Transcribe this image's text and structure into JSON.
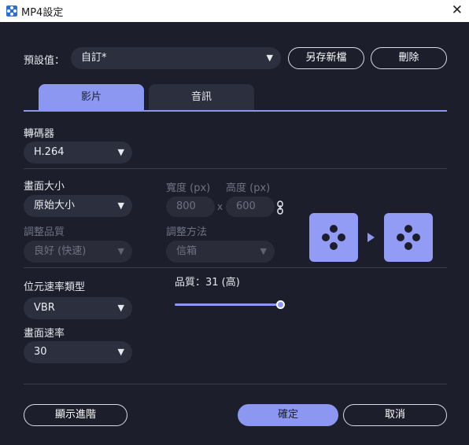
{
  "window": {
    "title": "MP4設定",
    "close_glyph": "✕"
  },
  "preset": {
    "label": "預設值：",
    "value": "自訂*",
    "save_new_label": "另存新檔",
    "delete_label": "刪除"
  },
  "tabs": [
    {
      "label": "影片",
      "active": true
    },
    {
      "label": "音訊",
      "active": false
    }
  ],
  "encoder": {
    "label": "轉碼器",
    "value": "H.264"
  },
  "frame_size": {
    "label": "畫面大小",
    "value": "原始大小",
    "width_label": "寬度 (px)",
    "height_label": "高度 (px)",
    "width_value": "800",
    "height_value": "600",
    "times": "x",
    "quality_label": "調整品質",
    "quality_value": "良好 (快速)",
    "method_label": "調整方法",
    "method_value": "信箱"
  },
  "bitrate": {
    "label": "位元速率類型",
    "value": "VBR"
  },
  "quality": {
    "label": "品質：31 (高)",
    "level": 1.0
  },
  "frame_rate": {
    "label": "畫面速率",
    "value": "30"
  },
  "footer": {
    "advanced_label": "顯示進階",
    "ok_label": "確定",
    "cancel_label": "取消"
  },
  "colors": {
    "accent": "#8c97f2",
    "background": "#1c1f2b",
    "field": "#2b2f3e"
  },
  "icons": {
    "chevron": "chevron-down-icon",
    "link": "link-icon",
    "preview": "preview-frame-icon"
  }
}
